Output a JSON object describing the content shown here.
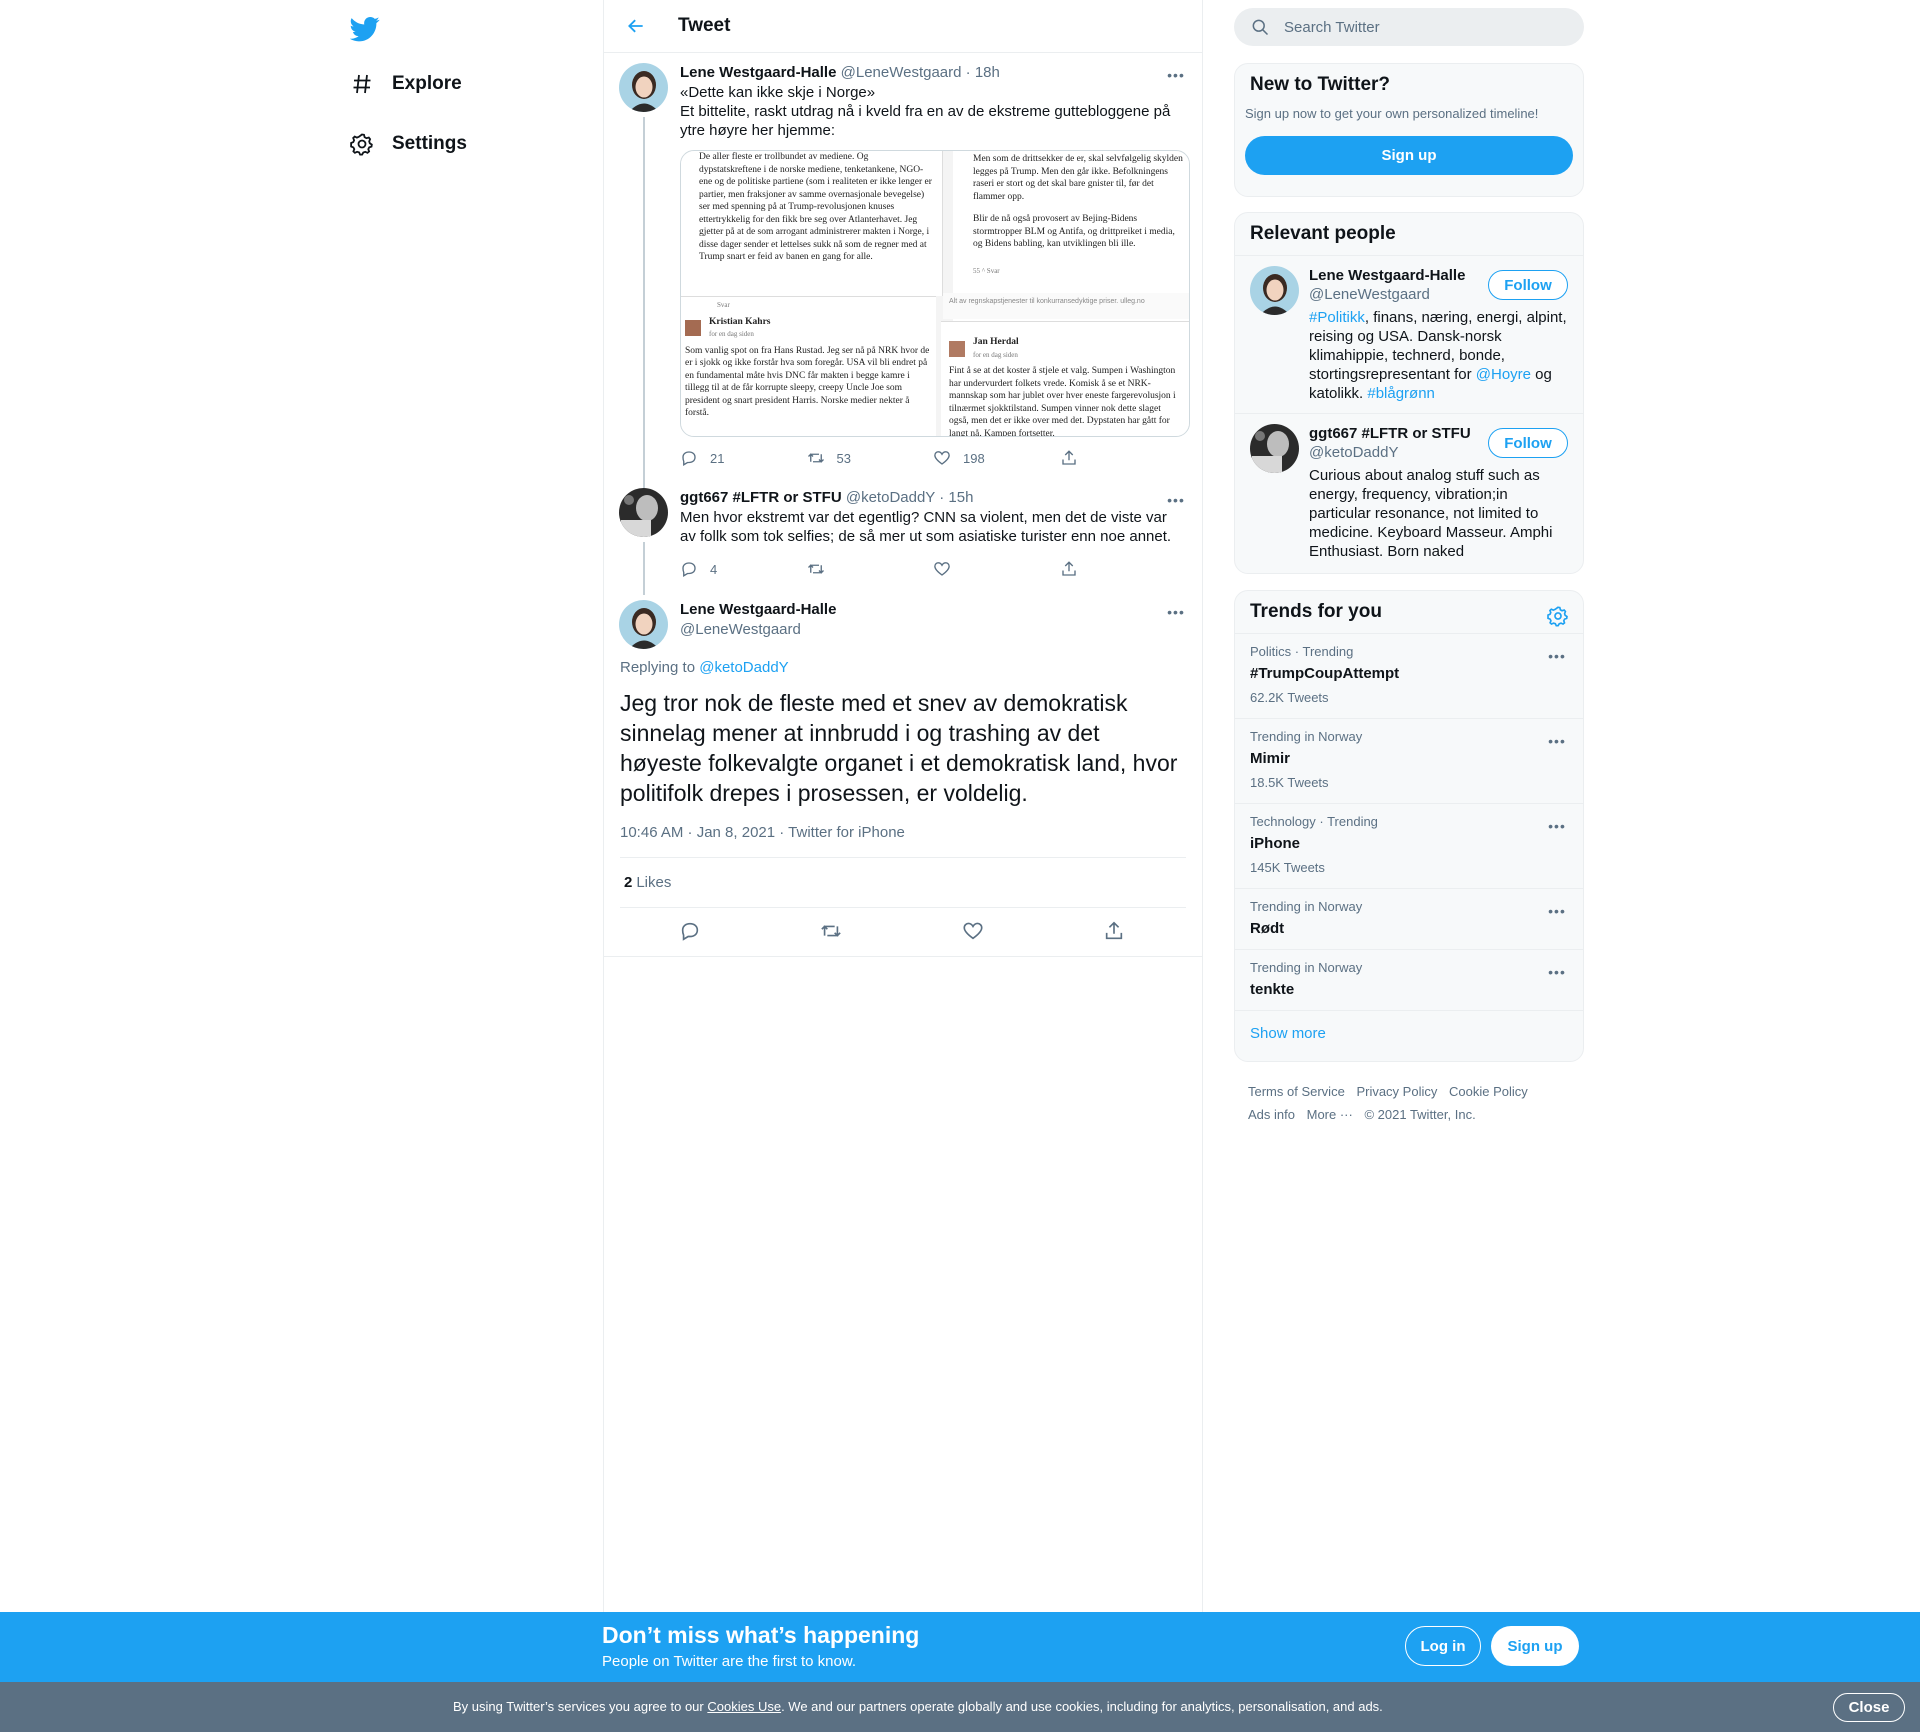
{
  "nav": {
    "explore": "Explore",
    "settings": "Settings"
  },
  "header": {
    "title": "Tweet"
  },
  "thread": [
    {
      "name": "Lene Westgaard-Halle",
      "handle": "@LeneWestgaard",
      "time": "18h",
      "text_line1": "«Dette kan ikke skje i Norge»",
      "text_line2": "Et bittelite, raskt utdrag nå i kveld fra en av de ekstreme guttebloggene på ytre høyre her hjemme:",
      "replies": "21",
      "retweets": "53",
      "likes": "198"
    },
    {
      "name": "ggt667 #LFTR or STFU",
      "handle": "@ketoDaddY",
      "time": "15h",
      "text": "Men hvor ekstremt var det egentlig? CNN sa violent, men det de viste var av follk som tok selfies; de så mer ut som asiatiske turister enn noe annet.",
      "replies": "4"
    }
  ],
  "media": {
    "left_top": "De aller fleste er trollbundet av mediene. Og dypstatskreftene i de norske mediene, tenketankene, NGO-ene og de politiske partiene (som i realiteten er ikke lenger er partier, men fraksjoner av samme overnasjonale bevegelse) ser med spenning på at Trump-revolusjonen knuses ettertrykkelig for den fikk bre seg over Atlanterhavet. Jeg gjetter på at de som arrogant administrerer makten i Norge, i disse dager sender et lettelses sukk nå som de regner med at Trump snart er feid av banen en gang for alle.",
    "right_top": "Men som de drittsekker de er, skal selvfølgelig skylden legges på Trump. Men den går ikke. Befolkningens raseri er stort og det skal bare gnister til, før det flammer opp.",
    "right_top2": "Blir de nå også provosert av Bejing-Bidens stormtropper BLM og Antifa, og drittpreiket i media, og Bidens babling, kan utviklingen bli ille.",
    "svar": "Svar",
    "name_a": "Kristian Kahrs",
    "date_a": "for en dag siden",
    "text_a": "Som vanlig spot on fra Hans Rustad. Jeg ser nå på NRK hvor de er i sjokk og ikke forstår hva som foregår. USA vil bli endret på en fundamental måte hvis DNC får makten i begge kamre i tillegg til at de får korrupte sleepy, creepy Uncle Joe som president og snart president Harris. Norske medier nekter å forstå.",
    "ad_text": "Alt av regnskapstjenester til konkurransedyktige priser. ulleg.no",
    "count_b": "55",
    "name_b": "Jan Herdal",
    "date_b": "for en dag siden",
    "text_b": "Fint å se at det koster å stjele et valg. Sumpen i Washington har undervurdert folkets vrede. Komisk å se et NRK-mannskap som har jublet over hver eneste fargerevolusjon i tilnærmet sjokktilstand. Sumpen vinner nok dette slaget også, men det er ikke over med det. Dypstaten har gått for langt nå. Kampen fortsetter."
  },
  "main_tweet": {
    "name": "Lene Westgaard-Halle",
    "handle": "@LeneWestgaard",
    "replying_label": "Replying to",
    "replying_to": "@ketoDaddY",
    "text": "Jeg tror nok de fleste med et snev av demokratisk sinnelag mener at innbrudd i og trashing av det høyeste folkevalgte organet i et demokratisk land, hvor politifolk drepes i prosessen, er voldelig.",
    "meta": "10:46 AM · Jan 8, 2021 · Twitter for iPhone",
    "likes_count": "2",
    "likes_label": "Likes"
  },
  "search": {
    "placeholder": "Search Twitter"
  },
  "new_to_twitter": {
    "title": "New to Twitter?",
    "subtitle": "Sign up now to get your own personalized timeline!",
    "button": "Sign up"
  },
  "relevant": {
    "title": "Relevant people",
    "follow_label": "Follow",
    "people": [
      {
        "name": "Lene Westgaard-Halle",
        "handle": "@LeneWestgaard",
        "bio_tag1": "#Politikk",
        "bio_mid": ", finans, næring, energi, alpint, reising og USA. Dansk-norsk klimahippie, technerd, bonde, stortingsrepresentant for ",
        "bio_tag2": "@Hoyre",
        "bio_mid2": " og katolikk. ",
        "bio_tag3": "#blågrønn"
      },
      {
        "name": "ggt667 #LFTR or STFU",
        "handle": "@ketoDaddY",
        "bio": "Curious about analog stuff such as energy, frequency, vibration;in particular resonance, not limited to medicine. Keyboard Masseur. Amphi Enthusiast. Born naked"
      }
    ]
  },
  "trends": {
    "title": "Trends for you",
    "items": [
      {
        "context": "Politics · Trending",
        "name": "#TrumpCoupAttempt",
        "count": "62.2K Tweets"
      },
      {
        "context": "Trending in Norway",
        "name": "Mimir",
        "count": "18.5K Tweets"
      },
      {
        "context": "Technology · Trending",
        "name": "iPhone",
        "count": "145K Tweets"
      },
      {
        "context": "Trending in Norway",
        "name": "Rødt",
        "count": ""
      },
      {
        "context": "Trending in Norway",
        "name": "tenkte",
        "count": ""
      }
    ],
    "show_more": "Show more"
  },
  "footer": {
    "terms": "Terms of Service",
    "privacy": "Privacy Policy",
    "cookie": "Cookie Policy",
    "ads": "Ads info",
    "more": "More ···",
    "copyright": "© 2021 Twitter, Inc."
  },
  "bottom_bar": {
    "title": "Don’t miss what’s happening",
    "subtitle": "People on Twitter are the first to know.",
    "login": "Log in",
    "signup": "Sign up"
  },
  "cookie_bar": {
    "text_before": "By using Twitter’s services you agree to our ",
    "link": "Cookies Use",
    "text_after": ". We and our partners operate globally and use cookies, including for analytics, personalisation, and ads.",
    "close": "Close"
  },
  "colors": {
    "brand": "#1da1f2",
    "text": "#0f1419",
    "secondary": "#5b7083",
    "cookie_bg": "#5b7083"
  }
}
